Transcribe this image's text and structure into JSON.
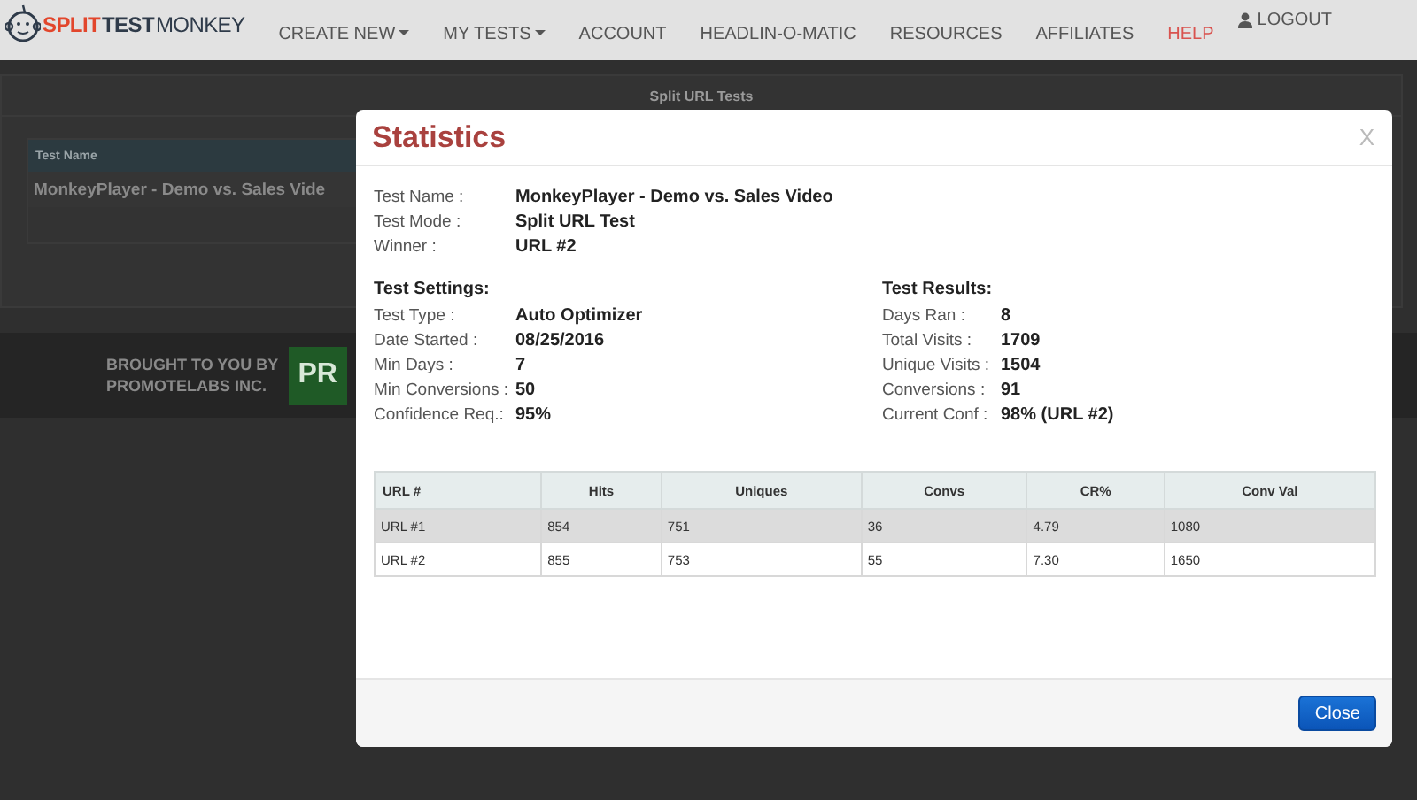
{
  "navbar": {
    "logo": [
      {
        "text": "SPLIT",
        "color": "#e2462c",
        "bold": true
      },
      {
        "text": "TEST",
        "color": "#2f3b4a",
        "bold": true
      },
      {
        "text": "MONKEY",
        "color": "#2f3b4a",
        "bold": false
      }
    ],
    "menu": [
      {
        "label": "CREATE NEW",
        "dropdown": true,
        "color": "#555555"
      },
      {
        "label": "MY TESTS",
        "dropdown": true,
        "color": "#555555"
      },
      {
        "label": "ACCOUNT",
        "dropdown": false,
        "color": "#555555"
      },
      {
        "label": "HEADLIN-O-MATIC",
        "dropdown": false,
        "color": "#555555"
      },
      {
        "label": "RESOURCES",
        "dropdown": false,
        "color": "#555555"
      },
      {
        "label": "AFFILIATES",
        "dropdown": false,
        "color": "#555555"
      },
      {
        "label": "HELP",
        "dropdown": false,
        "color": "#d9534f"
      }
    ],
    "logout": "LOGOUT"
  },
  "page": {
    "title": "Split URL Tests",
    "table_header": "Test Name",
    "row": "MonkeyPlayer - Demo vs. Sales Vide",
    "footer": {
      "credit_line_1": "BROUGHT TO YOU BY",
      "credit_line_2": "PROMOTELABS INC.",
      "logo": "PR"
    }
  },
  "modal": {
    "title": "Statistics",
    "close_x": "X",
    "info": [
      {
        "label": "Test Name :",
        "value": "MonkeyPlayer - Demo vs. Sales Video"
      },
      {
        "label": "Test Mode :",
        "value": "Split URL Test"
      },
      {
        "label": "Winner :",
        "value": "URL #2"
      }
    ],
    "settings": {
      "heading": "Test Settings:",
      "rows": [
        {
          "label": "Test Type :",
          "value": "Auto Optimizer"
        },
        {
          "label": "Date Started :",
          "value": "08/25/2016"
        },
        {
          "label": "Min Days :",
          "value": "7"
        },
        {
          "label": "Min Conversions :",
          "value": "50"
        },
        {
          "label": "Confidence Req.:",
          "value": "95%"
        }
      ]
    },
    "results": {
      "heading": "Test Results:",
      "rows": [
        {
          "label": "Days Ran :",
          "value": "8"
        },
        {
          "label": "Total Visits :",
          "value": "1709"
        },
        {
          "label": "Unique Visits :",
          "value": "1504"
        },
        {
          "label": "Conversions :",
          "value": "91"
        },
        {
          "label": "Current Conf :",
          "value": "98% (URL #2)"
        }
      ]
    },
    "table": {
      "columns": [
        "URL #",
        "Hits",
        "Uniques",
        "Convs",
        "CR%",
        "Conv Val"
      ],
      "rows": [
        {
          "cells": [
            "URL #1",
            "854",
            "751",
            "36",
            "4.79",
            "1080"
          ],
          "selected": true
        },
        {
          "cells": [
            "URL #2",
            "855",
            "753",
            "55",
            "7.30",
            "1650"
          ],
          "selected": false
        }
      ]
    },
    "close_button": "Close"
  }
}
